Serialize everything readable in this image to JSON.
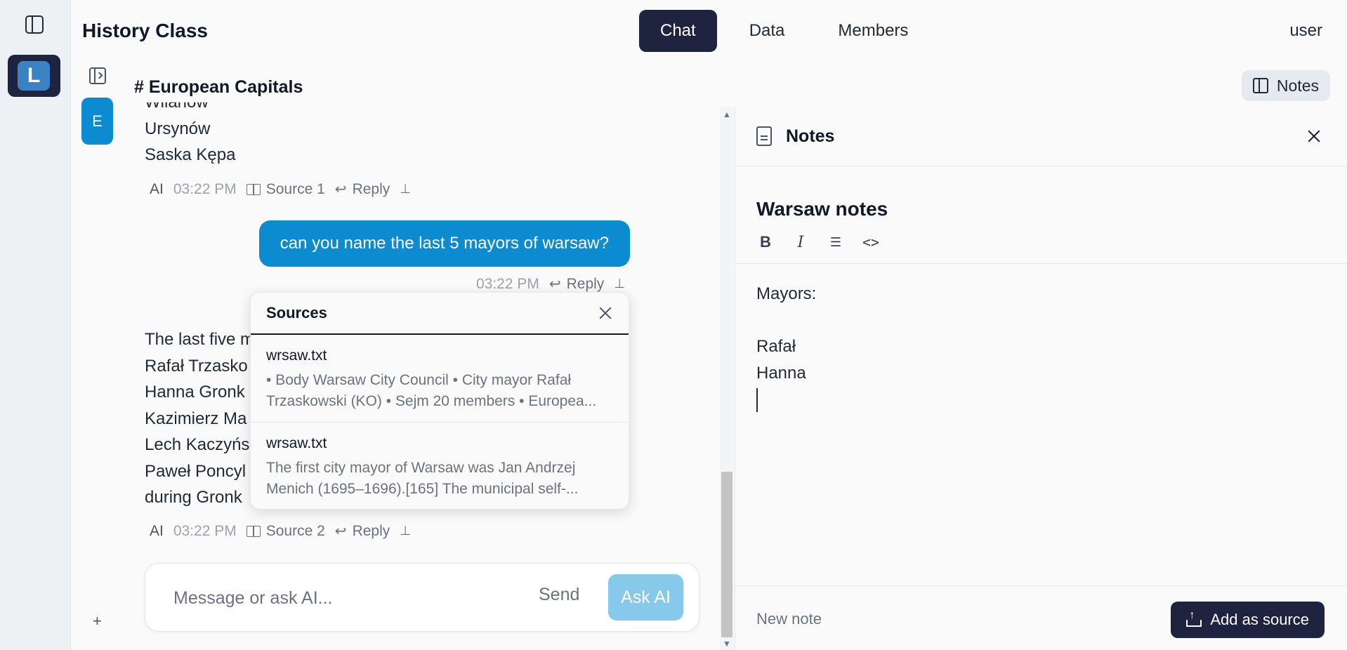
{
  "app": {
    "title": "History Class",
    "workspace_initial": "L"
  },
  "nav": {
    "tabs": [
      "Chat",
      "Data",
      "Members"
    ],
    "active_tab": "Chat",
    "user": "user"
  },
  "channel": {
    "title": "# European Capitals",
    "notes_toggle_label": "Notes",
    "avatar_initial": "E"
  },
  "messages": [
    {
      "lines": [
        "Wilanów",
        "Ursynów",
        "Saska Kępa"
      ],
      "sender": "AI",
      "time": "03:22 PM",
      "source_label": "Source 1",
      "reply_label": "Reply"
    },
    {
      "text": "can you name the last 5 mayors of warsaw?",
      "time": "03:22 PM",
      "reply_label": "Reply"
    },
    {
      "lines": [
        "The last five m",
        "Rafał Trzasko",
        "Hanna Gronk",
        "Kazimierz Ma",
        "Lech Kaczyńs",
        "Paweł Poncyl",
        "during Gronk"
      ],
      "sender": "AI",
      "time": "03:22 PM",
      "source_label": "Source 2",
      "reply_label": "Reply"
    }
  ],
  "sources_popover": {
    "title": "Sources",
    "items": [
      {
        "name": "wrsaw.txt",
        "snippet": "• Body Warsaw City Council • City mayor Rafał Trzaskowski (KO) • Sejm 20 members • Europea..."
      },
      {
        "name": "wrsaw.txt",
        "snippet": "The first city mayor of Warsaw was Jan Andrzej Menich (1695–1696).[165] The municipal self-..."
      }
    ]
  },
  "composer": {
    "placeholder": "Message or ask AI...",
    "send_label": "Send",
    "ask_label": "Ask AI",
    "add_symbol": "+"
  },
  "notes": {
    "panel_title": "Notes",
    "note_title": "Warsaw notes",
    "toolbar": {
      "bold": "B",
      "italic": "I",
      "list": "☰",
      "code": "<>"
    },
    "body_lines": [
      "Mayors:",
      "",
      "Rafał",
      "Hanna"
    ],
    "new_note_label": "New note",
    "add_source_label": "Add as source"
  },
  "icons": {
    "rail_toggle": "sidebar-toggle-icon",
    "collapse": "panel-collapse-icon",
    "book": "book-icon",
    "reply": "reply-icon",
    "pin": "pin-icon",
    "close": "close-icon",
    "document": "document-icon",
    "upload": "upload-icon"
  },
  "colors": {
    "primary_dark": "#1e2340",
    "accent_blue": "#0c8bd0",
    "ask_ai_light": "#86c9ea"
  }
}
